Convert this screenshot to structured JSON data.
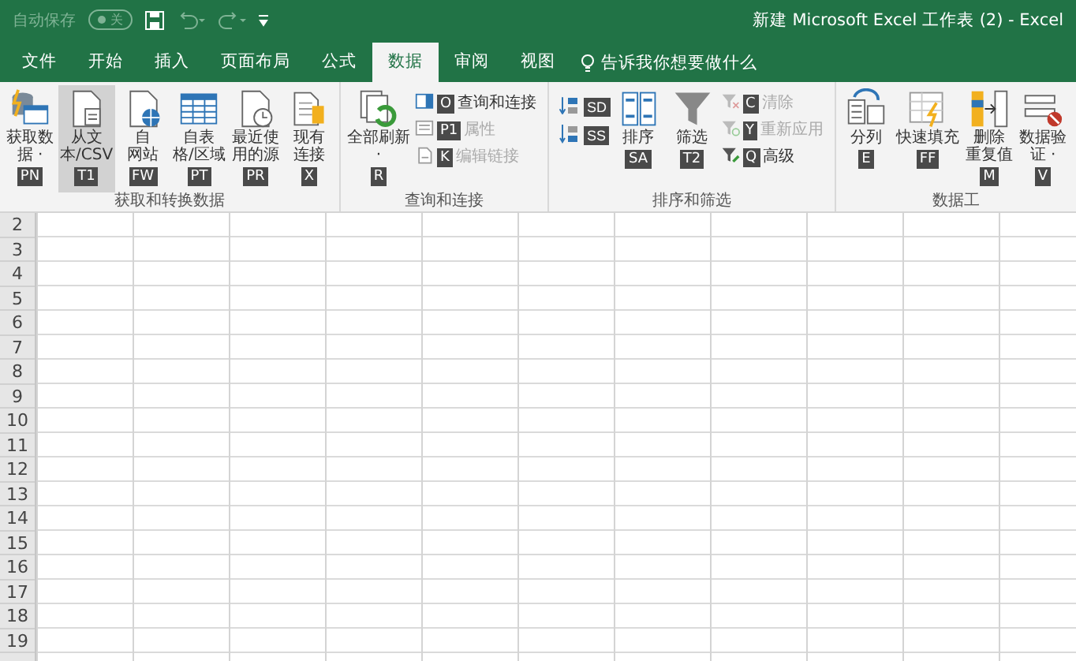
{
  "titlebar": {
    "autosave_label": "自动保存",
    "autosave_toggle": {
      "text": "关",
      "on": false
    },
    "title": "新建 Microsoft Excel 工作表 (2)  -  Excel"
  },
  "tabs": [
    {
      "label": "文件",
      "selected": false
    },
    {
      "label": "开始",
      "selected": false
    },
    {
      "label": "插入",
      "selected": false
    },
    {
      "label": "页面布局",
      "selected": false
    },
    {
      "label": "公式",
      "selected": false
    },
    {
      "label": "数据",
      "selected": true
    },
    {
      "label": "审阅",
      "selected": false
    },
    {
      "label": "视图",
      "selected": false
    }
  ],
  "tell_me": "告诉我你想要做什么",
  "groups": [
    {
      "label": "获取和转换数据",
      "items": [
        {
          "kind": "large",
          "lines": [
            "获取数",
            "据 ·"
          ],
          "keytip": "PN",
          "highlighted": false
        },
        {
          "kind": "large",
          "lines": [
            "从文",
            "本/CSV"
          ],
          "keytip": "T1",
          "highlighted": true
        },
        {
          "kind": "large",
          "lines": [
            "自",
            "网站"
          ],
          "keytip": "FW",
          "highlighted": false
        },
        {
          "kind": "large",
          "lines": [
            "自表",
            "格/区域"
          ],
          "keytip": "PT",
          "highlighted": false
        },
        {
          "kind": "large",
          "lines": [
            "最近使",
            "用的源"
          ],
          "keytip": "PR",
          "highlighted": false
        },
        {
          "kind": "large",
          "lines": [
            "现有",
            "连接"
          ],
          "keytip": "X",
          "highlighted": false
        }
      ]
    },
    {
      "label": "查询和连接",
      "items": [
        {
          "kind": "large",
          "lines": [
            "全部刷新",
            "·"
          ],
          "keytip": "R",
          "highlighted": false
        },
        {
          "kind": "small_column",
          "items": [
            {
              "label": "查询和连接",
              "keytip": "O",
              "disabled": false
            },
            {
              "label": "属性",
              "keytip": "P1",
              "disabled": true
            },
            {
              "label": "编辑链接",
              "keytip": "K",
              "disabled": true
            }
          ]
        }
      ]
    },
    {
      "label": "排序和筛选",
      "items": [
        {
          "kind": "icon_column",
          "buttons": [
            {
              "keytip": "SD"
            },
            {
              "keytip": "SS"
            }
          ]
        },
        {
          "kind": "large",
          "lines": [
            "排序"
          ],
          "keytip": "SA",
          "highlighted": false
        },
        {
          "kind": "large",
          "lines": [
            "筛选"
          ],
          "keytip": "T2",
          "highlighted": false
        },
        {
          "kind": "small_column",
          "items": [
            {
              "label": "清除",
              "keytip": "C",
              "disabled": true
            },
            {
              "label": "重新应用",
              "keytip": "Y",
              "disabled": true
            },
            {
              "label": "高级",
              "keytip": "Q",
              "disabled": false
            }
          ]
        }
      ]
    },
    {
      "label": "数据工",
      "items": [
        {
          "kind": "large",
          "lines": [
            "分列"
          ],
          "keytip": "E",
          "highlighted": false
        },
        {
          "kind": "large",
          "lines": [
            "快速填充"
          ],
          "keytip": "FF",
          "highlighted": false
        },
        {
          "kind": "large",
          "lines": [
            "删除",
            "重复值"
          ],
          "keytip": "M",
          "highlighted": false
        },
        {
          "kind": "large",
          "lines": [
            "数据验",
            "证 ·"
          ],
          "keytip": "V",
          "highlighted": false
        }
      ]
    }
  ],
  "row_numbers": [
    "2",
    "3",
    "4",
    "5",
    "6",
    "7",
    "8",
    "9",
    "10",
    "11",
    "12",
    "13",
    "14",
    "15",
    "16",
    "17",
    "18",
    "19"
  ]
}
